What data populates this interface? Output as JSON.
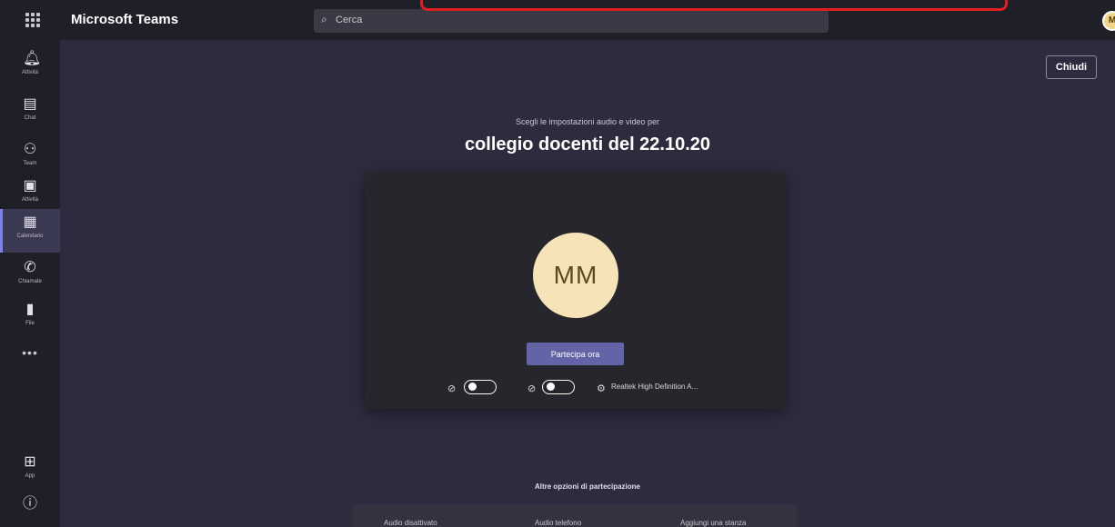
{
  "titlebar": {
    "app_title": "Microsoft Teams",
    "search_placeholder": "Cerca",
    "user_initial": "M"
  },
  "rail": {
    "items": [
      {
        "label": "Attività",
        "icon": "bell-icon"
      },
      {
        "label": "Chat",
        "icon": "chat-icon"
      },
      {
        "label": "Team",
        "icon": "teams-icon"
      },
      {
        "label": "Attività",
        "icon": "bag-icon"
      },
      {
        "label": "Calendario",
        "icon": "calendar-icon"
      },
      {
        "label": "Chiamate",
        "icon": "phone-icon"
      },
      {
        "label": "File",
        "icon": "file-icon"
      }
    ],
    "more": "•••",
    "bottom": [
      {
        "label": "App",
        "icon": "apps-icon"
      },
      {
        "label": "Guida",
        "icon": "help-icon"
      }
    ]
  },
  "main": {
    "close_label": "Chiudi",
    "subtitle": "Scegli le impostazioni audio e video per",
    "meeting_title": "collegio docenti del 22.10.20",
    "avatar_initials": "MM",
    "join_label": "Partecipa ora",
    "audio_device": "Realtek High Definition A...",
    "other_options_label": "Altre opzioni di partecipazione",
    "other_options": [
      "Audio disattivato",
      "Audio telefono",
      "Aggiungi una stanza"
    ]
  },
  "colors": {
    "accent": "#6264a7",
    "background": "#2d2c3e",
    "rail": "#1f1f28",
    "avatar": "#f6e3b8"
  }
}
